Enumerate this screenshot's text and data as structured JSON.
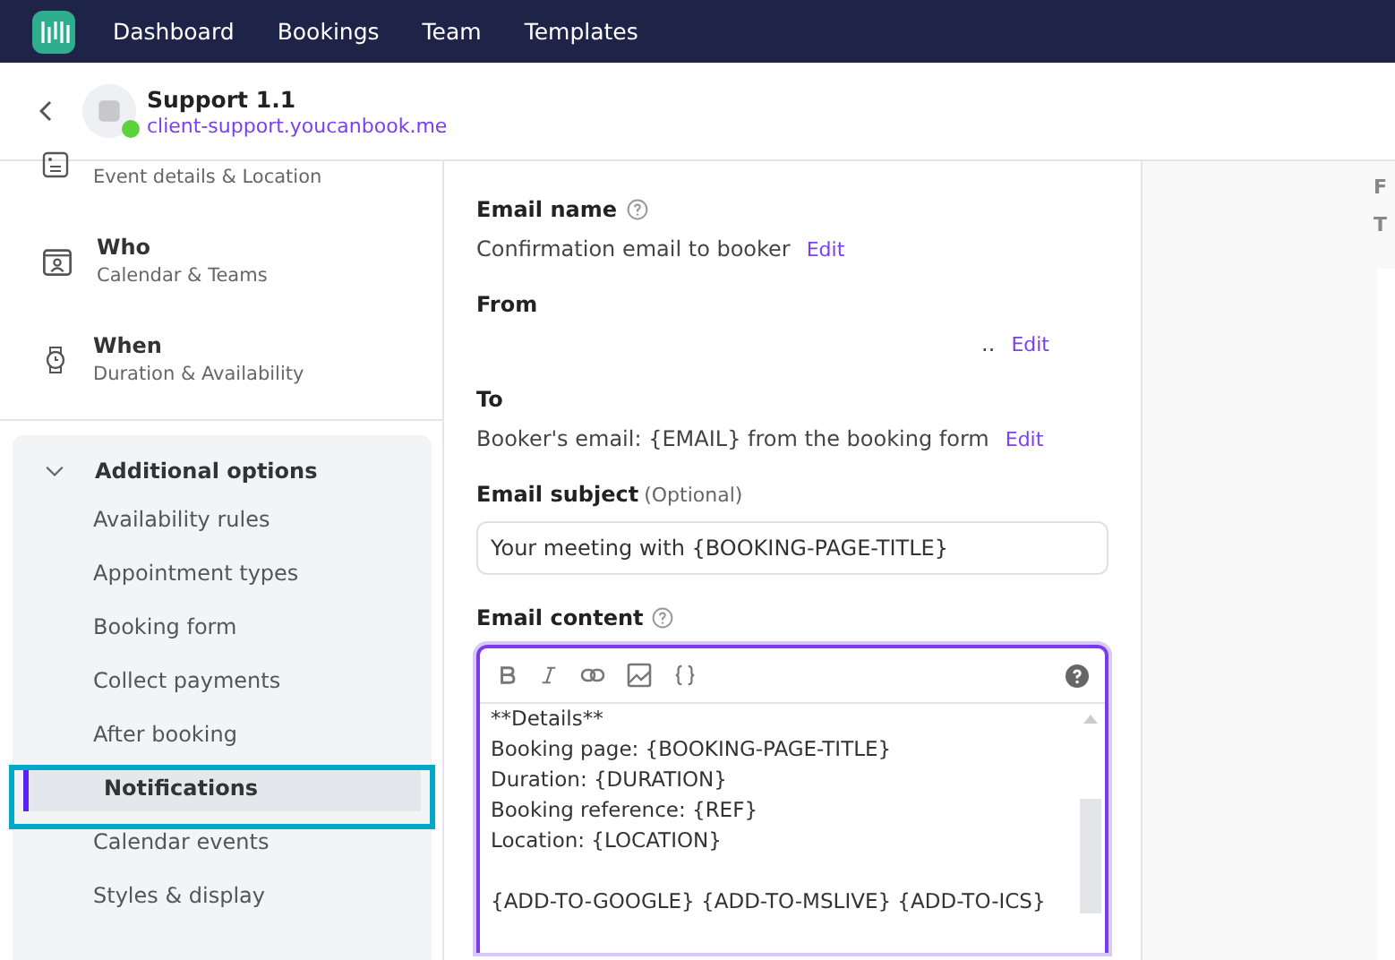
{
  "top_nav": {
    "items": [
      {
        "label": "Dashboard",
        "selected": false
      },
      {
        "label": "Bookings",
        "selected": false
      },
      {
        "label": "Team",
        "selected": false
      },
      {
        "label": "Templates",
        "selected": false
      }
    ]
  },
  "page_header": {
    "title": "Support 1.1",
    "url": "client-support.youcanbook.me",
    "online": true
  },
  "sidebar": {
    "sections": [
      {
        "kind": "doc",
        "subtitle": "Event details & Location"
      },
      {
        "kind": "calendar",
        "title": "Who",
        "subtitle": "Calendar & Teams"
      },
      {
        "kind": "watch",
        "title": "When",
        "subtitle": "Duration & Availability"
      }
    ],
    "group": {
      "title": "Additional options",
      "expanded": true,
      "items": [
        {
          "label": "Availability rules",
          "selected": false
        },
        {
          "label": "Appointment types",
          "selected": false
        },
        {
          "label": "Booking form",
          "selected": false
        },
        {
          "label": "Collect payments",
          "selected": false
        },
        {
          "label": "After booking",
          "selected": false
        },
        {
          "label": "Notifications",
          "selected": true
        },
        {
          "label": "Calendar events",
          "selected": false
        },
        {
          "label": "Styles & display",
          "selected": false
        }
      ]
    }
  },
  "form": {
    "email_name": {
      "label": "Email name",
      "value": "Confirmation email to booker",
      "edit": "Edit"
    },
    "from": {
      "label": "From",
      "value": "..",
      "edit": "Edit"
    },
    "to": {
      "label": "To",
      "value": "Booker's email: {EMAIL} from the booking form",
      "edit": "Edit"
    },
    "subject": {
      "label": "Email subject",
      "optional": "(Optional)",
      "value": "Your meeting with {BOOKING-PAGE-TITLE}"
    },
    "content": {
      "label": "Email content",
      "paragraphs": [
        [
          "**Details**",
          "Booking page: {BOOKING-PAGE-TITLE}",
          "Duration: {DURATION}",
          "Booking reference: {REF}",
          "Location: {LOCATION}"
        ],
        [
          "{ADD-TO-GOOGLE} {ADD-TO-MSLIVE} {ADD-TO-ICS}"
        ]
      ]
    }
  },
  "preview": {
    "labels": [
      "F",
      "T"
    ]
  }
}
